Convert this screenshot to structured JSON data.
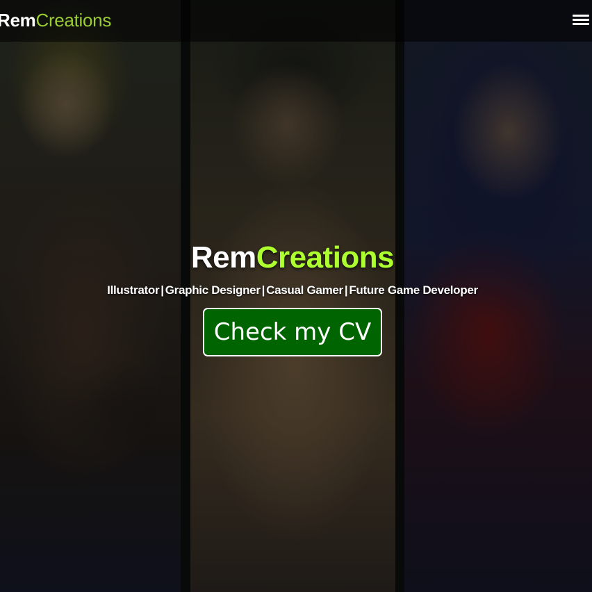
{
  "navbar": {
    "brand_part_1": "Rem",
    "brand_part_2": "Creations",
    "menu_icon": "hamburger-menu-icon"
  },
  "hero": {
    "title_part_1": "Rem",
    "title_part_2": "Creations",
    "subtitle_items": [
      "Illustrator",
      "Graphic Designer",
      "Casual Gamer",
      "Future Game Developer"
    ],
    "separator": "|",
    "cta_label": "Check my CV"
  },
  "colors": {
    "brand_accent": "#adff2f",
    "nav_accent": "#9acd32",
    "cta_background": "#006400",
    "cta_border": "#ffffff"
  }
}
